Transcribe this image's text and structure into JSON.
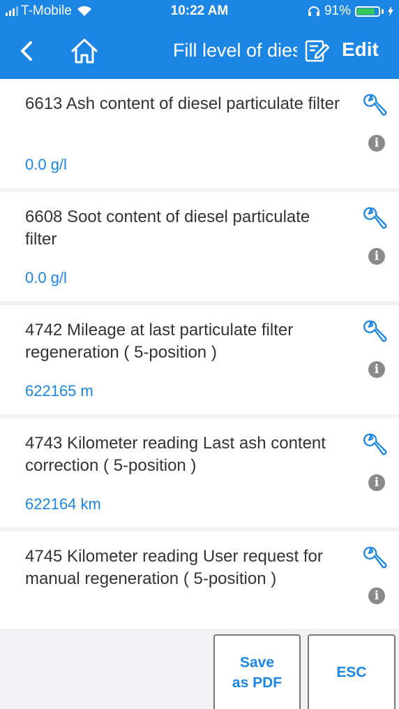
{
  "status_bar": {
    "carrier": "T-Mobile",
    "time": "10:22 AM",
    "battery": "91%",
    "battery_level": 0.91,
    "icons": [
      "signal-icon",
      "wifi-icon",
      "headphones-icon",
      "battery-icon",
      "charging-icon"
    ]
  },
  "nav": {
    "title": "Fill level of diesel particulate filter",
    "edit_label": "Edit",
    "icons": [
      "back-chevron-icon",
      "home-icon",
      "edit-note-icon"
    ]
  },
  "items": [
    {
      "title": "6613  Ash content of diesel particulate filter",
      "value": "0.0 g/l"
    },
    {
      "title": "6608  Soot content of diesel particulate filter",
      "value": "0.0 g/l"
    },
    {
      "title": "4742  Mileage at last particulate filter regeneration ( 5-position )",
      "value": "622165 m"
    },
    {
      "title": "4743  Kilometer reading Last ash content correction ( 5-position )",
      "value": "622164 km"
    },
    {
      "title": "4745  Kilometer reading User request for manual regeneration ( 5-position )",
      "value": ""
    }
  ],
  "item_icons": [
    "wrench-icon",
    "info-icon"
  ],
  "info_glyph": "i",
  "buttons": {
    "save_pdf_line1": "Save",
    "save_pdf_line2": "as PDF",
    "esc": "ESC"
  },
  "colors": {
    "accent": "#1b86e3",
    "background": "#f2f2f4",
    "text": "#333333",
    "battery": "#34c759"
  }
}
